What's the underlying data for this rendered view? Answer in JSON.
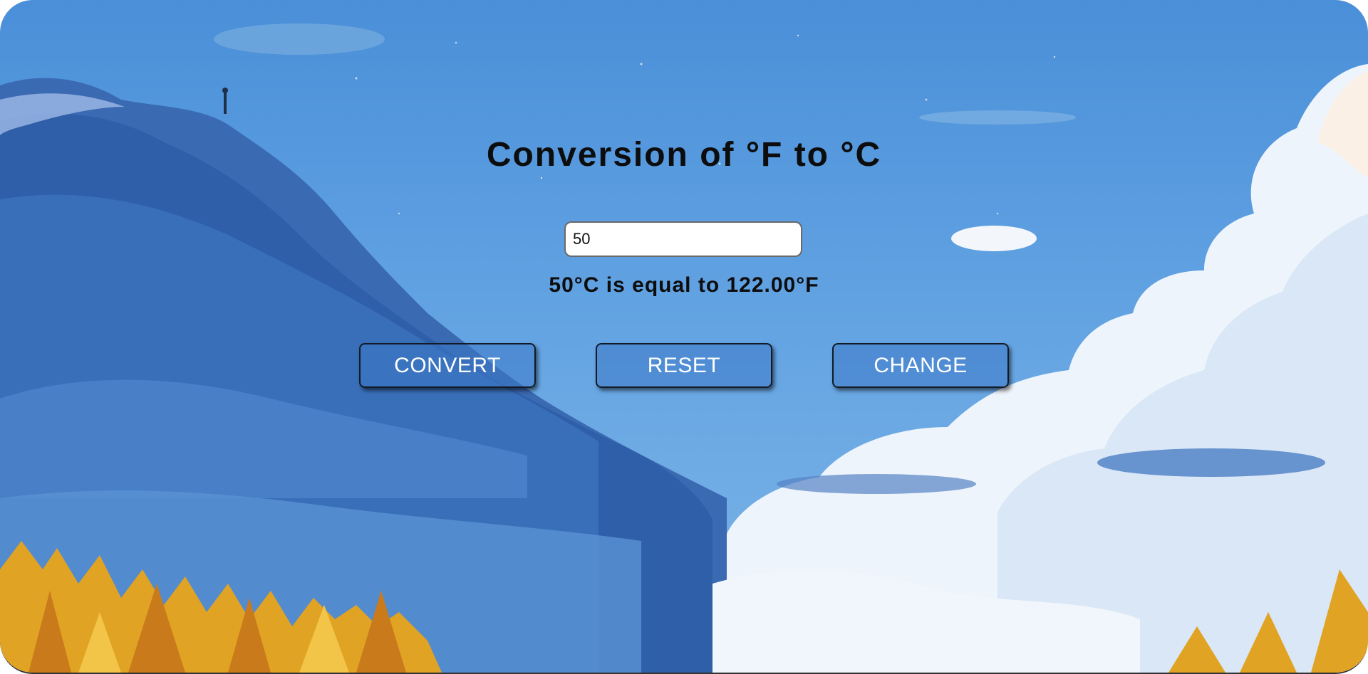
{
  "converter": {
    "title": "Conversion of °F to °C",
    "input_value": "50",
    "result_text": "50°C is equal to 122.00°F"
  },
  "buttons": {
    "convert_label": "CONVERT",
    "reset_label": "RESET",
    "change_label": "CHANGE"
  },
  "colors": {
    "sky": "#5c9ee0",
    "mountain": "#2f5fa8",
    "cloud": "#eef4fb",
    "foliage": "#e0a323",
    "button_fill": "#3c78c8"
  }
}
